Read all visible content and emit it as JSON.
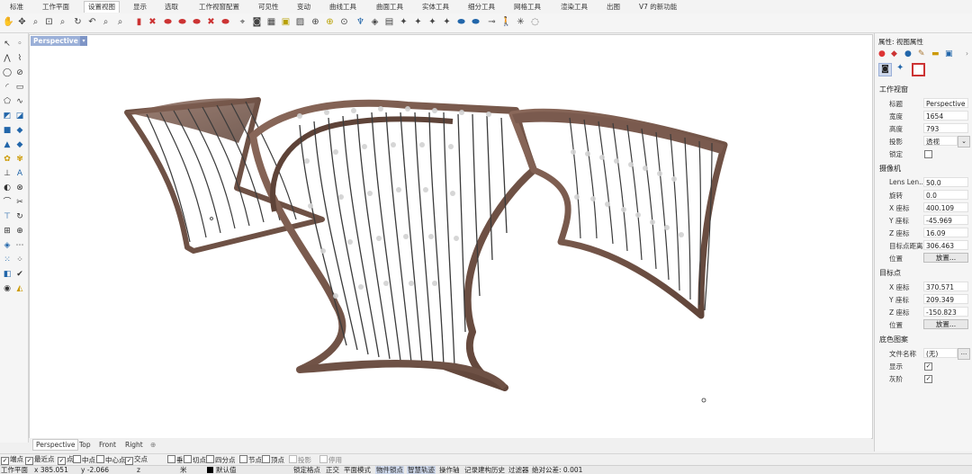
{
  "tabs": [
    "标准",
    "工作平面",
    "设置视图",
    "显示",
    "选取",
    "工作视窗配置",
    "可见性",
    "变动",
    "曲线工具",
    "曲面工具",
    "实体工具",
    "细分工具",
    "网格工具",
    "渲染工具",
    "出图",
    "V7 的新功能"
  ],
  "active_tab_index": 2,
  "viewport": {
    "label": "Perspective",
    "dropdown_glyph": "▾"
  },
  "view_tabs": [
    "Perspective",
    "Top",
    "Front",
    "Right"
  ],
  "view_tab_add": "⊕",
  "osnaps": [
    {
      "label": "端点",
      "checked": true
    },
    {
      "label": "最近点",
      "checked": true
    },
    {
      "label": "点",
      "checked": true
    },
    {
      "label": "中点",
      "checked": false
    },
    {
      "label": "中心点",
      "checked": false
    },
    {
      "label": "交点",
      "checked": true
    },
    {
      "label": "垂点",
      "checked": false
    },
    {
      "label": "切点",
      "checked": false
    },
    {
      "label": "四分点",
      "checked": false
    },
    {
      "label": "节点",
      "checked": false
    },
    {
      "label": "顶点",
      "checked": false
    },
    {
      "label": "投影",
      "checked": false
    },
    {
      "label": "停用",
      "checked": false
    }
  ],
  "status": {
    "cplane": "工作平面",
    "x": "x 385.051",
    "y": "y -2.066",
    "z": "z",
    "unit": "米",
    "layer": "默认值",
    "grid_snap": "锁定格点",
    "ortho": "正交",
    "planar": "平面模式",
    "osnap": "物件锁点",
    "smarttrack": "智慧轨迹",
    "gumball": "操作轴",
    "history": "记录建构历史",
    "filter": "过滤器",
    "tolerance": "绝对公差: 0.001"
  },
  "panel": {
    "title": "属性: 视图属性",
    "section_viewport": "工作视窗",
    "title_label": "标题",
    "title_value": "Perspective",
    "width_label": "宽度",
    "width_value": "1654",
    "height_label": "高度",
    "height_value": "793",
    "projection_label": "投影",
    "projection_value": "透视",
    "lock_label": "锁定",
    "section_camera": "摄像机",
    "lens_label": "Lens Len...",
    "lens_value": "50.0",
    "rotation_label": "旋转",
    "rotation_value": "0.0",
    "cam_x_label": "X 座标",
    "cam_x_value": "400.109",
    "cam_y_label": "Y 座标",
    "cam_y_value": "-45.969",
    "cam_z_label": "Z 座标",
    "cam_z_value": "16.09",
    "target_dist_label": "目标点距离",
    "target_dist_value": "306.463",
    "cam_pos_label": "位置",
    "cam_pos_button": "放置...",
    "section_target": "目标点",
    "tgt_x_label": "X 座标",
    "tgt_x_value": "370.571",
    "tgt_y_label": "Y 座标",
    "tgt_y_value": "209.349",
    "tgt_z_label": "Z 座标",
    "tgt_z_value": "-150.823",
    "tgt_pos_label": "位置",
    "tgt_pos_button": "放置...",
    "section_wallpaper": "底色图案",
    "file_label": "文件名称",
    "file_value": "(无)",
    "file_browse": "...",
    "show_label": "显示",
    "gray_label": "灰阶"
  },
  "colors": {
    "wood": "#7a5a4e",
    "wood_dark": "#5e4338",
    "rib": "#3b3b3b",
    "bead": "#d2d2d2",
    "viewport_label": "#9bb0d8"
  }
}
